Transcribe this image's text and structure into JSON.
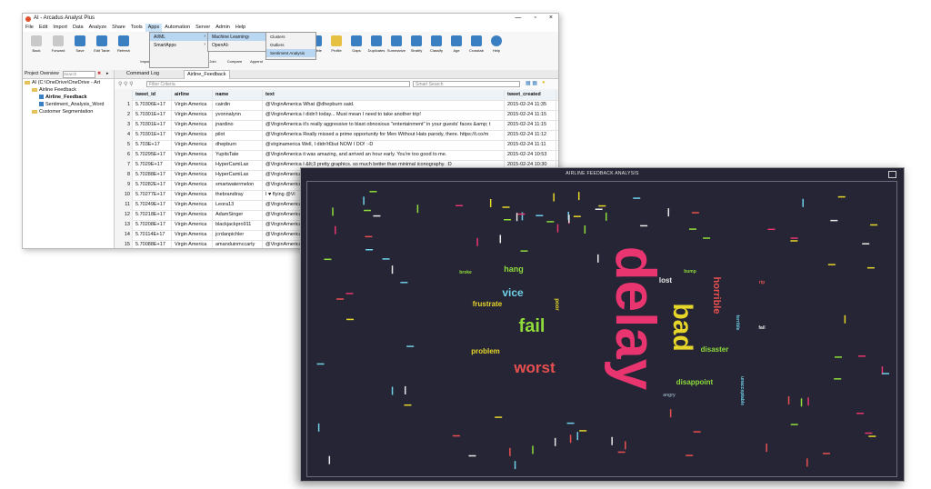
{
  "app": {
    "title": "AI - Arcadus Analyst Plus",
    "window_buttons": [
      "—",
      "▫",
      "×"
    ],
    "menu": [
      "File",
      "Edit",
      "Import",
      "Data",
      "Analyze",
      "Share",
      "Tools",
      "Apps",
      "Automation",
      "Server",
      "Admin",
      "Help"
    ],
    "apps_menu": [
      "AI/ML",
      "SmartApps"
    ],
    "aiml_submenu": [
      "Machine Learning",
      "OpenAI"
    ],
    "ml_submenu": [
      "Clusters",
      "Outliers",
      "Sentiment Analysis"
    ],
    "ribbon_left": [
      "Back",
      "Forward",
      "Save",
      "Edit Table",
      "Refresh"
    ],
    "ribbon_sub_labels": [
      "Import",
      "Modify",
      "Text",
      "Join",
      "Compare",
      "Append"
    ],
    "ribbon_right": [
      "Visible",
      "Profile",
      "Gaps",
      "Duplicates",
      "Summarize",
      "Stratify",
      "Classify",
      "Age",
      "Crosstab",
      "Help"
    ]
  },
  "colors": {
    "accent": "#cce4f7",
    "wordcloud_bg": "#252535"
  },
  "project": {
    "header": "Project Overview",
    "search_placeholder": "Search",
    "tree": [
      "AI (C:\\OneDrive\\OneDrive - Art",
      "Airline Feedback",
      "Airline_Feedback",
      "Sentiment_Analysis_Word",
      "Customer Segmentation"
    ]
  },
  "tabs": [
    "Command Log",
    "Airline_Feedback"
  ],
  "filter_placeholder": "Filter Criteria",
  "smart_search_placeholder": "Smart Search",
  "table": {
    "columns": [
      "",
      "tweet_id",
      "airline",
      "name",
      "text",
      "tweet_created"
    ],
    "rows": [
      [
        "1",
        "5.70306E+17",
        "Virgin America",
        "cairdin",
        "@VirginAmerica What @dhepburn said.",
        "2015-02-24 11:35"
      ],
      [
        "2",
        "5.70301E+17",
        "Virgin America",
        "yvonnalynn",
        "@VirginAmerica I didn't today... Must mean I need to take another trip!",
        "2015-02-24 11:15"
      ],
      [
        "3",
        "5.70301E+17",
        "Virgin America",
        "jnardino",
        "@VirginAmerica it's really aggressive to blast obnoxious \"entertainment\" in your guests' faces &amp; t",
        "2015-02-24 11:15"
      ],
      [
        "4",
        "5.70301E+17",
        "Virgin America",
        "pilot",
        "@VirginAmerica Really missed a prime opportunity for Men Without Hats parody, there. https://t.co/m",
        "2015-02-24 11:12"
      ],
      [
        "5",
        "5.703E+17",
        "Virgin America",
        "dhepburn",
        "@virginamerica Well, I didn't€but NOW I DO! :-D",
        "2015-02-24 11:11"
      ],
      [
        "6",
        "5.70295E+17",
        "Virgin America",
        "YupitsTate",
        "@VirginAmerica it was amazing, and arrived an hour early. You're too good to me.",
        "2015-02-24 10:53"
      ],
      [
        "7",
        "5.7029E+17",
        "Virgin America",
        "HyperCamiLax",
        "@VirginAmerica I &lt;3 pretty graphics. so much better than minimal iconography. :D",
        "2015-02-24 10:30"
      ],
      [
        "8",
        "5.70288E+17",
        "Virgin America",
        "HyperCamiLax",
        "@VirginAmerica",
        "2015-02-24"
      ],
      [
        "9",
        "5.70282E+17",
        "Virgin America",
        "smartwatermelon",
        "@VirginAmerica",
        "2015-02-24"
      ],
      [
        "10",
        "5.70277E+17",
        "Virgin America",
        "thebrandiray",
        "I ♥ flying @Vi",
        "2015-02-24"
      ],
      [
        "11",
        "5.70249E+17",
        "Virgin America",
        "Leora13",
        "@VirginAmerica",
        "2015-02-24"
      ],
      [
        "12",
        "5.70218E+17",
        "Virgin America",
        "AdamSinger",
        "@VirginAmerica",
        "2015-02-24"
      ],
      [
        "13",
        "5.70208E+17",
        "Virgin America",
        "blackjackpro911",
        "@VirginAmerica",
        "2015-02-24"
      ],
      [
        "14",
        "5.70114E+17",
        "Virgin America",
        "jcrdanpichler",
        "@VirginAmerica",
        "2015-02-24"
      ],
      [
        "15",
        "5.70088E+17",
        "Virgin America",
        "amanduinmccarty",
        "@VirginAmerica",
        "2015-02-24"
      ]
    ]
  },
  "wordcloud": {
    "title": "AIRLINE FEEDBACK ANALYSIS",
    "words": [
      {
        "text": "delay",
        "color": "#e8356f",
        "rot": 90
      },
      {
        "text": "bad",
        "color": "#e6d62a",
        "rot": 90
      },
      {
        "text": "fail",
        "color": "#8fdc3a",
        "rot": 0
      },
      {
        "text": "worst",
        "color": "#e8504f",
        "rot": 0
      },
      {
        "text": "horrible",
        "color": "#e8504f",
        "rot": 90
      },
      {
        "text": "vice",
        "color": "#6fd0e8",
        "rot": 0
      },
      {
        "text": "hang",
        "color": "#8fdc3a",
        "rot": 0
      },
      {
        "text": "frustrate",
        "color": "#e6d62a",
        "rot": 0
      },
      {
        "text": "problem",
        "color": "#e6d62a",
        "rot": 0
      },
      {
        "text": "lost",
        "color": "#e8e8e8",
        "rot": 0
      },
      {
        "text": "disaster",
        "color": "#8fdc3a",
        "rot": 0
      },
      {
        "text": "disappoint",
        "color": "#8fdc3a",
        "rot": 0
      },
      {
        "text": "poor",
        "color": "#e6d62a",
        "rot": 90
      },
      {
        "text": "broke",
        "color": "#8fdc3a",
        "rot": 0
      },
      {
        "text": "bump",
        "color": "#8fdc3a",
        "rot": 0
      },
      {
        "text": "angry",
        "color": "#8aa0b0",
        "rot": 0
      },
      {
        "text": "terrible",
        "color": "#6fd0e8",
        "rot": 90
      },
      {
        "text": "unacceptable",
        "color": "#6fd0e8",
        "rot": 90
      },
      {
        "text": "fail",
        "color": "#e8e8e8",
        "rot": 0
      },
      {
        "text": "rip",
        "color": "#e8504f",
        "rot": 0
      }
    ]
  }
}
